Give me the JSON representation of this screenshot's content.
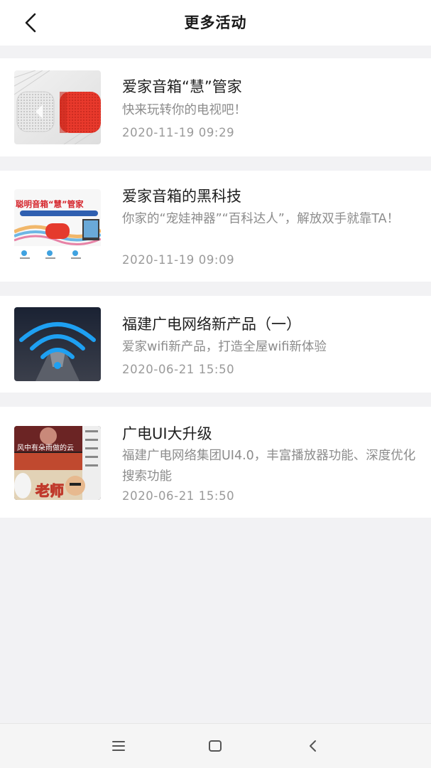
{
  "header": {
    "title": "更多活动",
    "back_icon": "chevron-left-icon"
  },
  "activities": [
    {
      "title": "爱家音箱“慧”管家",
      "desc": "快来玩转你的电视吧！",
      "date": "2020-11-19 09:29",
      "thumb_caption": ""
    },
    {
      "title": "爱家音箱的黑科技",
      "desc": "你家的“宠娃神器”“百科达人”，解放双手就靠TA！",
      "date": "2020-11-19 09:09",
      "thumb_caption": "聪明音箱“慧”管家"
    },
    {
      "title": "福建广电网络新产品（一）",
      "desc": "爱家wifi新产品，打造全屋wifi新体验",
      "date": "2020-06-21 15:50",
      "thumb_caption": ""
    },
    {
      "title": "广电UI大升级",
      "desc": "福建广电网络集团UI4.0，丰富播放器功能、深度优化搜索功能",
      "date": "2020-06-21 15:50",
      "thumb_caption": "老师",
      "thumb_caption_2": "风中有朵雨做的云"
    }
  ],
  "navbar": {
    "menu_icon": "menu-icon",
    "home_icon": "home-square-icon",
    "back_icon": "back-triangle-icon"
  },
  "colors": {
    "background": "#f2f2f4",
    "card": "#ffffff",
    "title_text": "#1e1e1e",
    "secondary_text": "#8c8c8c",
    "speaker_red": "#e8392c",
    "wifi_blue": "#1e9ff2"
  }
}
